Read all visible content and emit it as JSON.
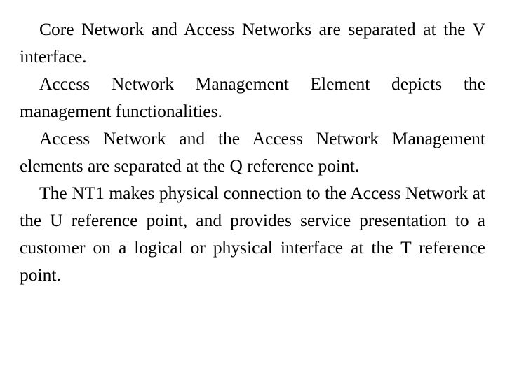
{
  "document": {
    "background_color": "#ffffff",
    "text_color": "#000000",
    "alignment": "justified",
    "first_line_indent": "28px",
    "paragraphs": [
      {
        "id": "p1",
        "text": "Core Network and Access Networks are separated at the V interface."
      },
      {
        "id": "p2",
        "text": "Access Network Management Element depicts the management functionalities."
      },
      {
        "id": "p3",
        "text": "Access Network and the Access Network Management elements are separated at the Q reference point."
      },
      {
        "id": "p4",
        "text": "The NT1 makes physical connection to the Access Network at the U reference point, and provides service presentation to a customer on a logical or physical interface at the T reference point."
      }
    ],
    "lines": [
      "Core Network and Access Networks are",
      "separated at the V interface.",
      "Access Network Management Element depicts",
      "the management functionalities.",
      "Access Network and the Access Network",
      "Management elements are separated at the Q",
      "reference point.",
      "The NT1 makes physical connection to the",
      "Access Network at the U reference point, and",
      "provides service presentation to a customer on a",
      "logical or physical interface at the T reference",
      "point."
    ]
  }
}
